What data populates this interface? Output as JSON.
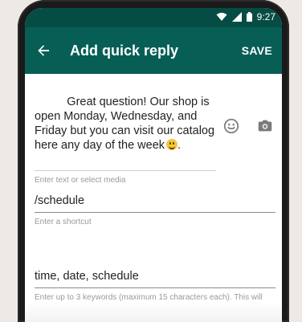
{
  "status": {
    "time": "9:27",
    "wifi_icon": "wifi-icon",
    "signal_icon": "signal-icon",
    "battery_icon": "battery-icon"
  },
  "header": {
    "back_icon": "arrow-left-icon",
    "title": "Add quick reply",
    "save_label": "SAVE",
    "bg_color": "#075e54"
  },
  "form": {
    "message": {
      "text": "Great question! Our shop is open Monday, Wednesday, and Friday but you can visit our catalog here any day of the week",
      "helper": "Enter text or select media",
      "emoji_icon": "emoji-icon",
      "camera_icon": "camera-icon"
    },
    "shortcut": {
      "value": "/schedule",
      "helper": "Enter a shortcut"
    },
    "keywords": {
      "value": "time, date, schedule",
      "helper": "Enter up to 3 keywords (maximum 15 characters each). This will help you find shortcuts later."
    }
  }
}
